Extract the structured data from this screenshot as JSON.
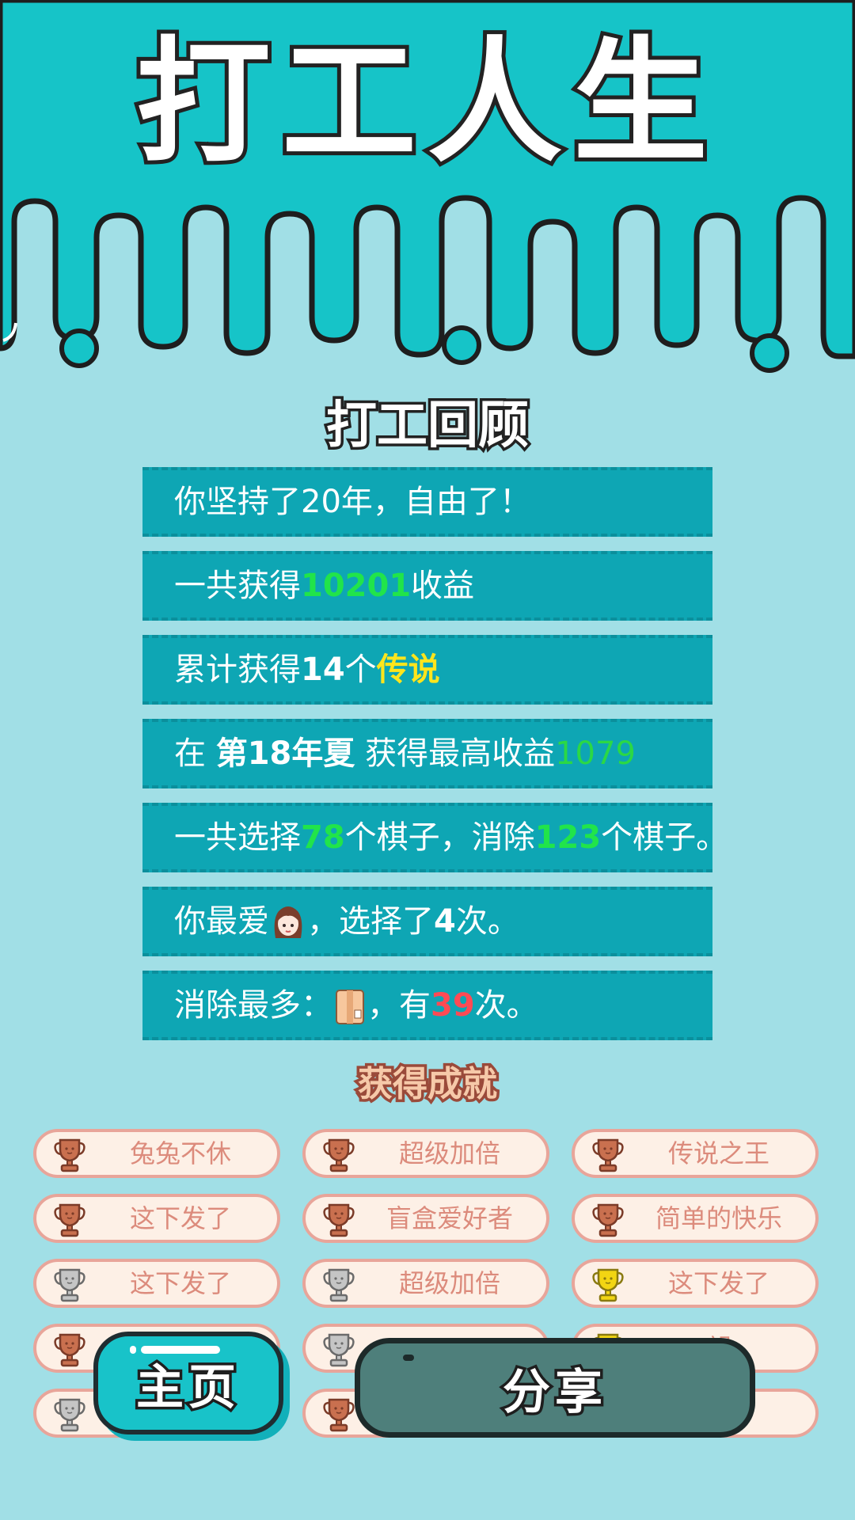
{
  "app": {
    "title": "打工人生"
  },
  "review": {
    "title": "打工回顾",
    "row1": {
      "text": "你坚持了20年，自由了！"
    },
    "row2": {
      "prefix": "一共获得",
      "amount": "10201",
      "suffix": "收益"
    },
    "row3": {
      "prefix": "累计获得",
      "count": "14",
      "mid": "个",
      "tag": "传说"
    },
    "row4": {
      "prefix": "在 ",
      "season": "第18年夏",
      "mid": " 获得最高收益",
      "amount": "1079"
    },
    "row5": {
      "p1": "一共选择",
      "n1": "78",
      "p2": "个棋子，消除",
      "n2": "123",
      "p3": "个棋子。"
    },
    "row6": {
      "prefix": "你最爱",
      "icon": "girl-avatar-icon",
      "mid": "，选择了",
      "count": "4",
      "suffix": "次。"
    },
    "row7": {
      "prefix": "消除最多：",
      "icon": "book-icon",
      "mid": "，有",
      "count": "39",
      "suffix": "次。"
    }
  },
  "achievements": {
    "title": "获得成就",
    "items": [
      {
        "label": "兔兔不休",
        "trophy": "bronze"
      },
      {
        "label": "超级加倍",
        "trophy": "bronze"
      },
      {
        "label": "传说之王",
        "trophy": "bronze"
      },
      {
        "label": "这下发了",
        "trophy": "bronze"
      },
      {
        "label": "盲盒爱好者",
        "trophy": "bronze"
      },
      {
        "label": "简单的快乐",
        "trophy": "bronze"
      },
      {
        "label": "这下发了",
        "trophy": "silver"
      },
      {
        "label": "超级加倍",
        "trophy": "silver"
      },
      {
        "label": "这下发了",
        "trophy": "gold"
      },
      {
        "label": "",
        "trophy": "bronze"
      },
      {
        "label": "",
        "trophy": "silver"
      },
      {
        "label": "望",
        "trophy": "gold"
      },
      {
        "label": "",
        "trophy": "silver"
      },
      {
        "label": "",
        "trophy": "bronze"
      },
      {
        "label": "王",
        "trophy": "bronze"
      }
    ]
  },
  "buttons": {
    "home": "主页",
    "share": "分享"
  },
  "colors": {
    "teal": "#16c4c8",
    "background": "#a1dfe6",
    "row": "#0ea6b4",
    "bronze": "#c9704f",
    "silver": "#c5c5c5",
    "gold": "#f2d513"
  }
}
